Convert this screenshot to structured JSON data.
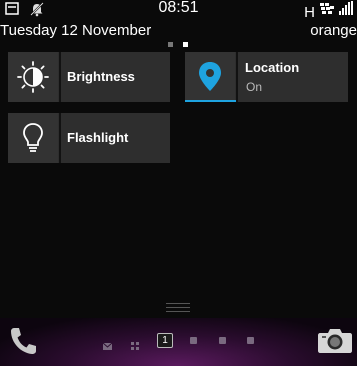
{
  "status_bar": {
    "time": "08:51",
    "network": "H",
    "icons": [
      "notification-icon",
      "silent-bell-icon",
      "blackberry-messenger-icon",
      "signal-icon"
    ]
  },
  "date_row": {
    "date": "Tuesday 12 November",
    "carrier": "orange"
  },
  "pages": {
    "count": 2,
    "active": 2
  },
  "tiles": [
    {
      "label": "Brightness",
      "icon": "brightness-icon"
    },
    {
      "label": "Location",
      "status": "On",
      "icon": "location-pin-icon",
      "active": true,
      "accent": "#1ea3e0"
    },
    {
      "label": "Flashlight",
      "icon": "lightbulb-icon"
    }
  ],
  "dock": {
    "phone_icon": "phone-icon",
    "camera_icon": "camera-icon",
    "active_page_label": "1",
    "indicators": [
      "messages-icon",
      "grid-icon",
      "page-1",
      "page-2",
      "page-3",
      "page-4"
    ]
  }
}
